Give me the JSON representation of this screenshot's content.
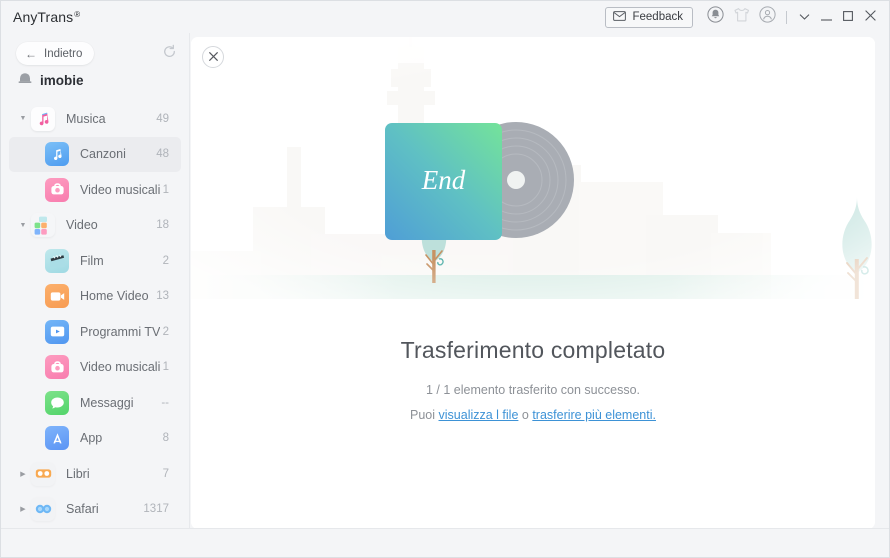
{
  "window": {
    "brand": "AnyTrans",
    "brand_reg": "®",
    "feedback_label": "Feedback",
    "icons": {
      "feedback": "envelope-icon",
      "bell": "bell-icon",
      "shirt": "shirt-icon",
      "account": "account-icon",
      "dropdown": "chevron-down-icon",
      "minimize": "minimize-icon",
      "maximize": "maximize-icon",
      "close": "close-icon"
    }
  },
  "sidebar": {
    "back_label": "Indietro",
    "refresh_icon": "refresh-icon",
    "device_name": "imobie",
    "device_icon": "device-icon",
    "items": [
      {
        "label": "Musica",
        "count": "49",
        "icon": "music-icon",
        "icon_class": "ic-music",
        "glyph": "♫",
        "glyph_color": "#f15fa0",
        "indent": false,
        "twisty": "down",
        "selected": false
      },
      {
        "label": "Canzoni",
        "count": "48",
        "icon": "song-icon",
        "icon_class": "ic-song",
        "glyph": "♪",
        "glyph_color": "#ffffff",
        "indent": true,
        "twisty": "none",
        "selected": true
      },
      {
        "label": "Video musicali",
        "count": "1",
        "icon": "music-video-icon",
        "icon_class": "ic-mv",
        "glyph": "▶",
        "glyph_color": "#ffffff",
        "indent": true,
        "twisty": "none",
        "selected": false
      },
      {
        "label": "Video",
        "count": "18",
        "icon": "video-group-icon",
        "icon_class": "ic-videogrp",
        "glyph": "▦",
        "glyph_color": "#7fb4fb",
        "indent": false,
        "twisty": "down",
        "selected": false
      },
      {
        "label": "Film",
        "count": "2",
        "icon": "film-icon",
        "icon_class": "ic-film",
        "glyph": "⬛",
        "glyph_color": "#ffffff",
        "indent": true,
        "twisty": "none",
        "selected": false
      },
      {
        "label": "Home Video",
        "count": "13",
        "icon": "home-video-icon",
        "icon_class": "ic-homevid",
        "glyph": "▶",
        "glyph_color": "#ffffff",
        "indent": true,
        "twisty": "none",
        "selected": false
      },
      {
        "label": "Programmi TV",
        "count": "2",
        "icon": "tv-show-icon",
        "icon_class": "ic-tv",
        "glyph": "▶",
        "glyph_color": "#ffffff",
        "indent": true,
        "twisty": "none",
        "selected": false
      },
      {
        "label": "Video musicali",
        "count": "1",
        "icon": "music-video-icon",
        "icon_class": "ic-mv",
        "glyph": "▶",
        "glyph_color": "#ffffff",
        "indent": true,
        "twisty": "none",
        "selected": false
      },
      {
        "label": "Messaggi",
        "count": "--",
        "icon": "messages-icon",
        "icon_class": "ic-msg",
        "glyph": "●",
        "glyph_color": "#ffffff",
        "indent": true,
        "twisty": "none",
        "selected": false
      },
      {
        "label": "App",
        "count": "8",
        "icon": "app-store-icon",
        "icon_class": "ic-app",
        "glyph": "A",
        "glyph_color": "#ffffff",
        "indent": true,
        "twisty": "none",
        "selected": false
      },
      {
        "label": "Libri",
        "count": "7",
        "icon": "books-icon",
        "icon_class": "ic-plain",
        "glyph": "◯",
        "glyph_color": "#f8a951",
        "indent": false,
        "twisty": "right",
        "selected": false
      },
      {
        "label": "Safari",
        "count": "1317",
        "icon": "safari-icon",
        "icon_class": "ic-plain",
        "glyph": "◯",
        "glyph_color": "#6fb8f5",
        "indent": false,
        "twisty": "right",
        "selected": false
      }
    ]
  },
  "main": {
    "close_icon": "close-icon",
    "album_label": "End",
    "title": "Trasferimento completato",
    "subtitle": "1 / 1 elemento trasferito con successo.",
    "links_prefix": "Puoi ",
    "link_view": "visualizza l file",
    "links_middle": " o ",
    "link_transfer": "trasferire più elementi.",
    "colors": {
      "album_gradient_start": "#4f9ed6",
      "album_gradient_end": "#74e39a",
      "disc": "#a9adb4",
      "tree_leaf": "#b6ded9",
      "tree_trunk": "#c79263",
      "link": "#3d92d6"
    }
  }
}
